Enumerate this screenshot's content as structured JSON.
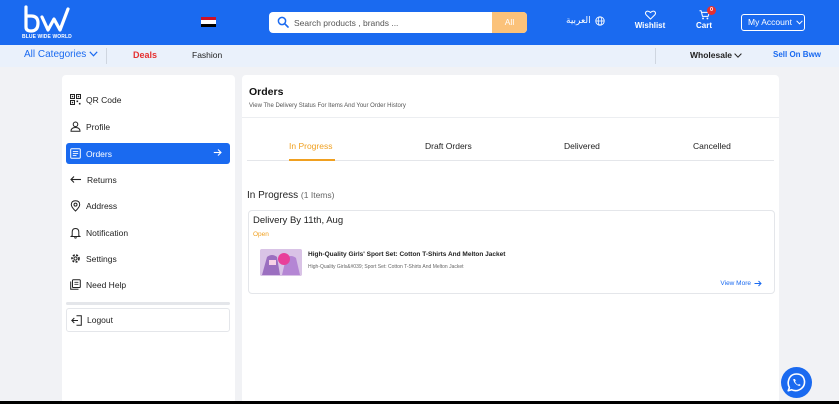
{
  "header": {
    "logo_text": "BLUE WIDE WORLD",
    "search_placeholder": "Search products , brands ...",
    "search_category": "All",
    "language": "العربية",
    "wishlist_label": "Wishlist",
    "cart_label": "Cart",
    "cart_count": "0",
    "account_label": "My Account",
    "accent_color": "#1a6af0"
  },
  "nav": {
    "categories_label": "All Categories",
    "deals_label": "Deals",
    "fashion_label": "Fashion",
    "wholesale_label": "Wholesale",
    "sell_label": "Sell On Bww"
  },
  "sidebar": {
    "items": [
      {
        "label": "QR Code",
        "icon": "qr-code-icon"
      },
      {
        "label": "Profile",
        "icon": "user-icon"
      },
      {
        "label": "Orders",
        "icon": "orders-icon",
        "active": true
      },
      {
        "label": "Returns",
        "icon": "return-arrow-icon"
      },
      {
        "label": "Address",
        "icon": "location-pin-icon"
      },
      {
        "label": "Notification",
        "icon": "bell-icon"
      },
      {
        "label": "Settings",
        "icon": "gear-icon"
      },
      {
        "label": "Need Help",
        "icon": "help-book-icon"
      }
    ],
    "logout_label": "Logout"
  },
  "main": {
    "title": "Orders",
    "subtitle": "View The Delivery Status For Items And Your Order History",
    "tabs": [
      "In Progress",
      "Draft Orders",
      "Delivered",
      "Cancelled"
    ],
    "active_tab": "In Progress",
    "section_title": "In Progress",
    "section_count": "(1 Items)",
    "order": {
      "delivery": "Delivery By 11th, Aug",
      "status": "Open",
      "product_name": "High-Quality Girls' Sport Set: Cotton T-Shirts And Melton Jacket",
      "product_desc": "High-Quality Girls&#039; Sport Set: Cotton T-Shirts And Melton Jacket",
      "view_more": "View More"
    }
  }
}
